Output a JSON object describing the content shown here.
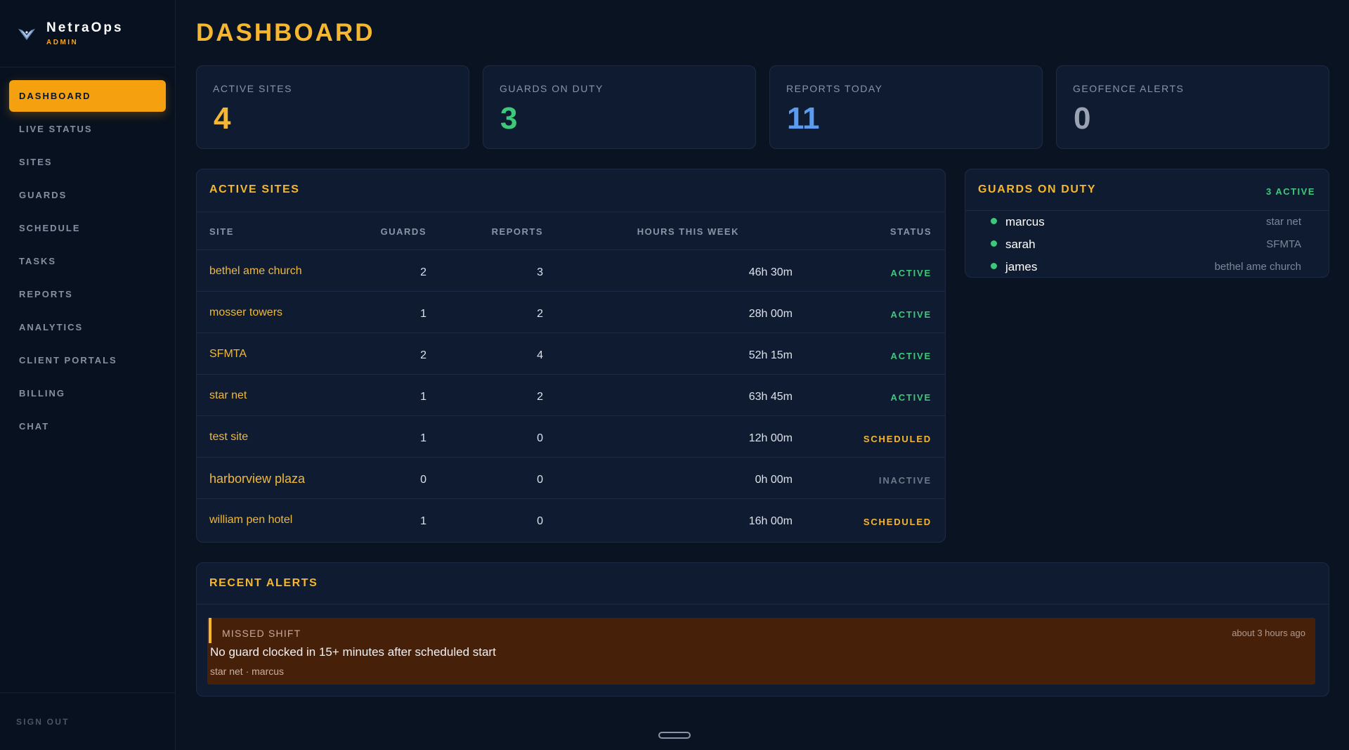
{
  "brand": {
    "name": "NetraOps",
    "sub": "ADMIN"
  },
  "nav": {
    "items": [
      {
        "label": "DASHBOARD",
        "active": true
      },
      {
        "label": "LIVE STATUS",
        "active": false
      },
      {
        "label": "SITES",
        "active": false
      },
      {
        "label": "GUARDS",
        "active": false
      },
      {
        "label": "SCHEDULE",
        "active": false
      },
      {
        "label": "TASKS",
        "active": false
      },
      {
        "label": "REPORTS",
        "active": false
      },
      {
        "label": "ANALYTICS",
        "active": false
      },
      {
        "label": "CLIENT PORTALS",
        "active": false
      },
      {
        "label": "BILLING",
        "active": false
      },
      {
        "label": "CHAT",
        "active": false
      }
    ],
    "signout": "SIGN OUT"
  },
  "page": {
    "title": "DASHBOARD"
  },
  "stats": [
    {
      "label": "ACTIVE SITES",
      "value": "4",
      "color": "#f5b731"
    },
    {
      "label": "GUARDS ON DUTY",
      "value": "3",
      "color": "#3ec97a"
    },
    {
      "label": "REPORTS TODAY",
      "value": "11",
      "color": "#5b9bf0"
    },
    {
      "label": "GEOFENCE ALERTS",
      "value": "0",
      "color": "#9aa3b2"
    }
  ],
  "sites": {
    "title": "ACTIVE SITES",
    "columns": {
      "site": "SITE",
      "guards": "GUARDS",
      "reports": "REPORTS",
      "hours": "HOURS THIS WEEK",
      "status": "STATUS"
    },
    "rows": [
      {
        "site": "bethel ame church",
        "guards": "2",
        "reports": "3",
        "hours": "46h 30m",
        "status": "ACTIVE"
      },
      {
        "site": "mosser towers",
        "guards": "1",
        "reports": "2",
        "hours": "28h 00m",
        "status": "ACTIVE"
      },
      {
        "site": "SFMTA",
        "guards": "2",
        "reports": "4",
        "hours": "52h 15m",
        "status": "ACTIVE"
      },
      {
        "site": "star net",
        "guards": "1",
        "reports": "2",
        "hours": "63h 45m",
        "status": "ACTIVE"
      },
      {
        "site": "test site",
        "guards": "1",
        "reports": "0",
        "hours": "12h 00m",
        "status": "SCHEDULED"
      },
      {
        "site": "harborview plaza",
        "guards": "0",
        "reports": "0",
        "hours": "0h 00m",
        "status": "INACTIVE"
      },
      {
        "site": "william pen hotel",
        "guards": "1",
        "reports": "0",
        "hours": "16h 00m",
        "status": "SCHEDULED"
      }
    ],
    "status_colors": {
      "ACTIVE": "#3ec97a",
      "SCHEDULED": "#f5b731",
      "INACTIVE": "#6f7889"
    }
  },
  "guards": {
    "title": "GUARDS ON DUTY",
    "badge": "3 ACTIVE",
    "list": [
      {
        "name": "marcus",
        "site": "star net"
      },
      {
        "name": "sarah",
        "site": "SFMTA"
      },
      {
        "name": "james",
        "site": "bethel ame church"
      }
    ]
  },
  "alerts": {
    "title": "RECENT ALERTS",
    "items": [
      {
        "type": "MISSED SHIFT",
        "time": "about 3 hours ago",
        "message": "No guard clocked in 15+ minutes after scheduled start",
        "meta": "star net · marcus"
      }
    ]
  }
}
